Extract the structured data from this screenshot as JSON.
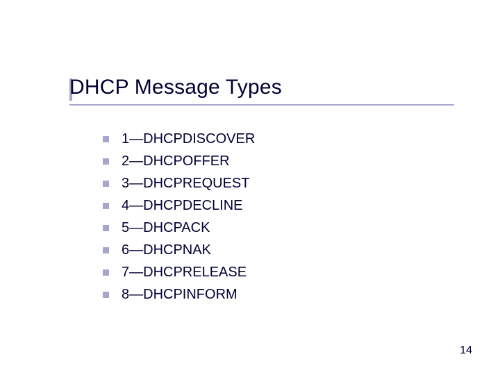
{
  "title": "DHCP Message Types",
  "items": [
    "1—DHCPDISCOVER",
    "2—DHCPOFFER",
    "3—DHCPREQUEST",
    "4—DHCPDECLINE",
    "5—DHCPACK",
    "6—DHCPNAK",
    "7—DHCPRELEASE",
    "8—DHCPINFORM"
  ],
  "page_number": "14"
}
